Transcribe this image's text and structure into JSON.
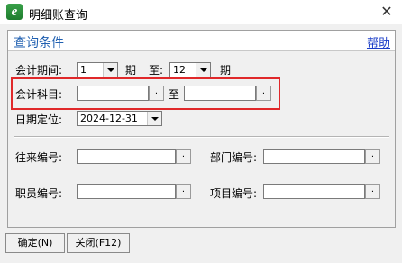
{
  "window": {
    "title": "明细账查询",
    "icon_letter": "e",
    "icon": "app-logo-icon",
    "close_glyph": "✕"
  },
  "panel": {
    "title": "查询条件",
    "help_label": "帮助"
  },
  "period": {
    "label": "会计期间:",
    "from_value": "1",
    "sep1": "期",
    "to_label": "至:",
    "to_value": "12",
    "sep2": "期"
  },
  "subject": {
    "label": "会计科目:",
    "from_value": "",
    "to_label": "至",
    "to_value": "",
    "button_glyph": "."
  },
  "date": {
    "label": "日期定位:",
    "value": "2024-12-31"
  },
  "fields": {
    "contact_label": "往来编号:",
    "dept_label": "部门编号:",
    "staff_label": "职员编号:",
    "project_label": "项目编号:",
    "button_glyph": "."
  },
  "buttons": {
    "confirm": "确定(N)",
    "close": "关闭(F12)"
  },
  "colors": {
    "highlight": "#e0282a",
    "panel_title": "#1f5fb0",
    "link": "#1a3cc8"
  }
}
